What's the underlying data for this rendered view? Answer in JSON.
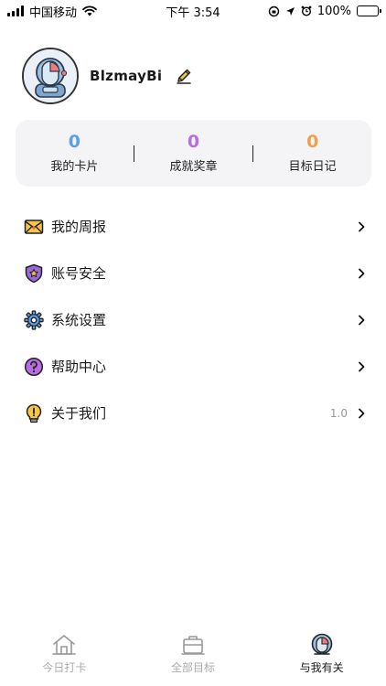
{
  "status_bar": {
    "carrier": "中国移动",
    "time": "下午 3:54",
    "battery": "100%"
  },
  "profile": {
    "username": "BlzmayBi"
  },
  "stats": [
    {
      "value": "0",
      "label": "我的卡片",
      "color": "#5b9fe8"
    },
    {
      "value": "0",
      "label": "成就奖章",
      "color": "#b76ee0"
    },
    {
      "value": "0",
      "label": "目标日记",
      "color": "#f0a04b"
    }
  ],
  "menu": [
    {
      "label": "我的周报",
      "icon": "envelope-icon"
    },
    {
      "label": "账号安全",
      "icon": "shield-star-icon"
    },
    {
      "label": "系统设置",
      "icon": "gear-icon"
    },
    {
      "label": "帮助中心",
      "icon": "question-icon"
    },
    {
      "label": "关于我们",
      "icon": "lightbulb-icon",
      "version": "1.0"
    }
  ],
  "tabs": [
    {
      "label": "今日打卡",
      "icon": "house-icon",
      "active": false
    },
    {
      "label": "全部目标",
      "icon": "briefcase-icon",
      "active": false
    },
    {
      "label": "与我有关",
      "icon": "profile-avatar-icon",
      "active": true
    }
  ]
}
